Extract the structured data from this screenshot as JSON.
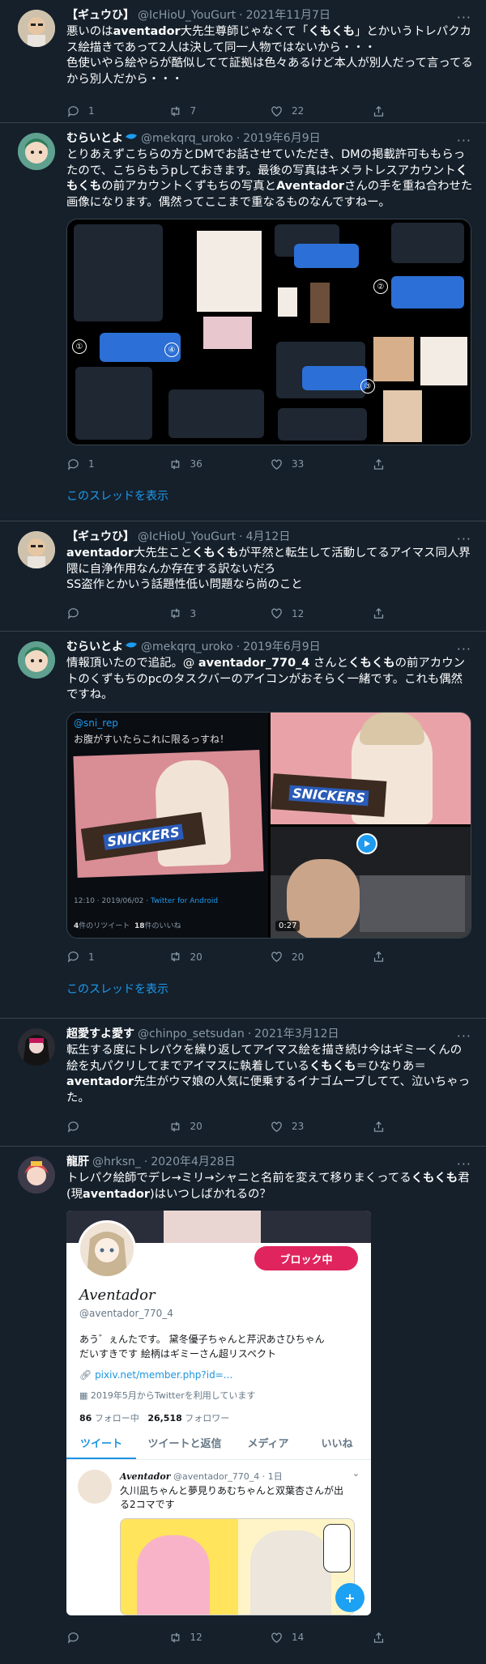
{
  "tweets": [
    {
      "name": "【ギュウひ】",
      "handle": "@IcHioU_YouGurt",
      "sep": "·",
      "date": "2021年11月7日",
      "text_parts": [
        "悪いのは",
        "aventador",
        "大先生尊師じゃなくて「",
        "くもくも",
        "」とかいうトレパクカス絵描きであって2人は決して同一人物ではないから・・・",
        "色使いやら絵やらが酷似してて証拠は色々あるけど本人が別人だって言ってるから別人だから・・・"
      ],
      "replies": "1",
      "retweets": "7",
      "likes": "22"
    },
    {
      "name": "むらいとよ",
      "handle": "@mekqrq_uroko",
      "sep": "·",
      "date": "2019年6月9日",
      "text_parts": [
        "とりあえずこちらの方とDMでお話させていただき、DMの掲載許可ももらったので、こちらもうpしておきます。最後の写真はキメラトレスアカウント",
        "くもくも",
        "の前アカウントくずもちの写真と",
        "Aventador",
        "さんの手を重ね合わせた画像になります。偶然ってここまで重なるものなんですねー。"
      ],
      "replies": "1",
      "retweets": "36",
      "likes": "33",
      "thread_link": "このスレッドを表示",
      "screenshot_numbers": [
        "①",
        "②",
        "③",
        "④"
      ]
    },
    {
      "name": "【ギュウひ】",
      "handle": "@IcHioU_YouGurt",
      "sep": "·",
      "date": "4月12日",
      "text_parts": [
        "aventador",
        "大先生こと",
        "くもくも",
        "が平然と転生して活動してるアイマス同人界隈に自浄作用なんか存在する訳ないだろ",
        "SS盗作とかいう話題性低い問題なら尚のこと"
      ],
      "replies": "",
      "retweets": "3",
      "likes": "12"
    },
    {
      "name": "むらいとよ",
      "handle": "@mekqrq_uroko",
      "sep": "·",
      "date": "2019年6月9日",
      "text_parts": [
        "情報頂いたので追記。@ ",
        "aventador_770_4",
        " さんと",
        "くもくも",
        "の前アカウントのくずもちのpcのタスクバーのアイコンがおそらく一緒です。これも偶然ですね。"
      ],
      "replies": "1",
      "retweets": "20",
      "likes": "20",
      "thread_link": "このスレッドを表示",
      "quote": {
        "handle": "@sni_rep",
        "text": "お腹がすいたらこれに限るっすね！",
        "snickers": "SNICKERS",
        "meta_time": "12:10 · 2019/06/02 · ",
        "meta_source": "Twitter for Android",
        "rt_count": "4",
        "rt_label": "件のリツイート",
        "like_count": "18",
        "like_label": "件のいいね",
        "video_time": "0:27"
      }
    },
    {
      "name": "超愛すよ愛す",
      "handle": "@chinpo_setsudan",
      "sep": "·",
      "date": "2021年3月12日",
      "text_parts": [
        "転生する度にトレパクを繰り返してアイマス絵を描き続け今はギミーくんの絵を丸パクリしてまでアイマスに執着している",
        "くもくも",
        "＝ひなりあ＝",
        "aventador",
        "先生がウマ娘の人気に便乗するイナゴムーブしてて、泣いちゃった。"
      ],
      "replies": "",
      "retweets": "20",
      "likes": "23"
    },
    {
      "name": "龍肝",
      "handle": "@hrksn_",
      "sep": "·",
      "date": "2020年4月28日",
      "text_parts": [
        "トレパク絵師でデレ→ミリ→シャニと名前を変えて移りまくってる",
        "くもくも",
        "君(現",
        "aventador",
        ")はいつしばかれるの？"
      ],
      "replies": "",
      "retweets": "12",
      "likes": "14",
      "profile": {
        "block_button": "ブロック中",
        "display_name": "Aventador",
        "handle": "@aventador_770_4",
        "bio_line1": "あう゛ぇんたです。 黛冬優子ちゃんと芹沢あさひちゃん",
        "bio_line2": "だいすきです 絵柄はギミーさん超リスペクト",
        "link": "pixiv.net/member.php?id=...",
        "joined": "2019年5月からTwitterを利用しています",
        "following_count": "86",
        "following_label": "フォロー中",
        "followers_count": "26,518",
        "followers_label": "フォロワー",
        "tabs": [
          "ツイート",
          "ツイートと返信",
          "メディア",
          "いいね"
        ],
        "inner_tweet": {
          "name": "Aventador",
          "handle": "@aventador_770_4",
          "sep": "·",
          "date": "1日",
          "text": "久川凪ちゃんと夢見りあむちゃんと双葉杏さんが出る2コマです"
        }
      }
    }
  ],
  "colors": {
    "background": "#15202b",
    "border": "#38444d",
    "muted": "#8899a6",
    "link": "#1d9bf0",
    "block": "#e0245e"
  },
  "icons": [
    "reply-icon",
    "retweet-icon",
    "like-icon",
    "share-icon",
    "more-icon",
    "verified-icon",
    "play-icon",
    "compose-icon"
  ]
}
